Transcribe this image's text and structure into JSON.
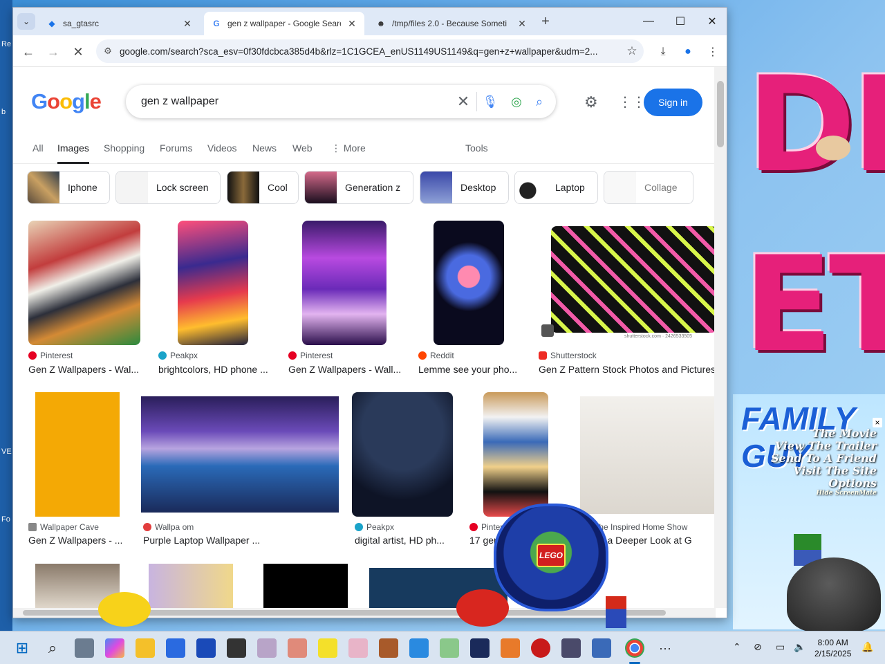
{
  "browser": {
    "tabs": [
      {
        "title": "sa_gtasrc",
        "active": false
      },
      {
        "title": "gen z wallpaper - Google Search",
        "active": true
      },
      {
        "title": "/tmp/files 2.0 - Because Someti",
        "active": false
      }
    ],
    "url": "google.com/search?sca_esv=0f30fdcbca385d4b&rlz=1C1GCEA_enUS1149US1149&q=gen+z+wallpaper&udm=2..."
  },
  "google": {
    "logo": [
      "G",
      "o",
      "o",
      "g",
      "l",
      "e"
    ],
    "query": "gen z wallpaper",
    "sign_in": "Sign in",
    "nav": [
      "All",
      "Images",
      "Shopping",
      "Forums",
      "Videos",
      "News",
      "Web",
      "More",
      "Tools"
    ],
    "active_nav": "Images",
    "chips": [
      "Iphone",
      "Lock screen",
      "Cool",
      "Generation z",
      "Desktop",
      "Laptop",
      "Collage"
    ],
    "results_row1": [
      {
        "source": "Pinterest",
        "title": "Gen Z Wallpapers - Wal...",
        "src_color": "#e60023"
      },
      {
        "source": "Peakpx",
        "title": "brightcolors, HD phone ...",
        "src_color": "#1aa3c9"
      },
      {
        "source": "Pinterest",
        "title": "Gen Z Wallpapers - Wall...",
        "src_color": "#e60023"
      },
      {
        "source": "Reddit",
        "title": "Lemme see your pho...",
        "src_color": "#ff4500"
      },
      {
        "source": "Shutterstock",
        "title": "Gen Z Pattern Stock Photos and Pictures",
        "src_color": "#ee2b24"
      }
    ],
    "results_row2": [
      {
        "source": "Wallpaper Cave",
        "title": "Gen Z Wallpapers - ...",
        "src_color": "#888888"
      },
      {
        "source": "Wallpa   om",
        "title": "Purple Laptop Wallpaper ...",
        "src_color": "#e23d3d"
      },
      {
        "source": "Peakpx",
        "title": "digital artist, HD ph...",
        "src_color": "#1aa3c9"
      },
      {
        "source": "Pinteres",
        "title": "17 gen z",
        "src_color": "#e60023"
      },
      {
        "source": "The Inspired Home Show",
        "title": "ng a Deeper Look at G",
        "src_color": "#777777"
      }
    ],
    "shutterstock_caption": "shutterstock.com · 2426533505"
  },
  "desktop": {
    "left_labels": [
      "Re",
      "b",
      "VE",
      "Fo"
    ],
    "family_guy": {
      "title": "FAMILY GUY",
      "menu": [
        "The Movie",
        "View The Trailer",
        "Send To A Friend",
        "Visit The Site",
        "Options"
      ],
      "credit": "Hide ScreenMate"
    },
    "lego_label": "LEGO"
  },
  "taskbar": {
    "time": "8:00 AM",
    "date": "2/15/2025"
  },
  "colors": {
    "accent": "#1a73e8",
    "tabbar": "#dfe9f7",
    "taskbar": "#d9e4f1"
  }
}
